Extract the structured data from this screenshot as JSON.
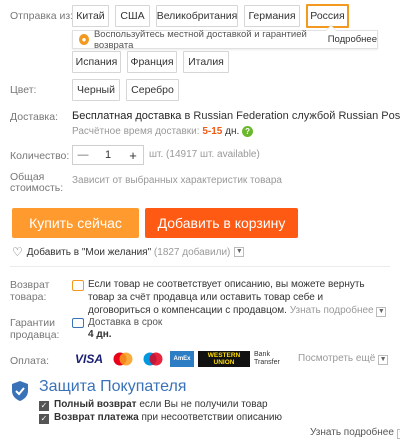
{
  "ship_from": {
    "label": "Отправка из:",
    "options": [
      "Китай",
      "США",
      "Великобритания",
      "Германия",
      "Россия",
      "Испания",
      "Франция",
      "Италия"
    ],
    "selected": "Россия",
    "tooltip_text": "Воспользуйтесь местной доставкой и гарантией возврата",
    "tooltip_link": "Подробнее"
  },
  "color": {
    "label": "Цвет:",
    "options": [
      "Черный",
      "Серебро"
    ]
  },
  "delivery": {
    "label": "Доставка:",
    "text_bold": "Бесплатная доставка",
    "text_rest": " в Russian Federation службой Russian Post",
    "eta_label": "Расчётное время доставки:",
    "eta_value": "5-15",
    "eta_unit": "дн."
  },
  "quantity": {
    "label": "Количество:",
    "minus": "—",
    "value": "1",
    "plus": "+",
    "unit": "шт. (14917 шт. available)"
  },
  "total": {
    "label_line1": "Общая",
    "label_line2": "стоимость:",
    "value": "Зависит от выбранных характеристик товара"
  },
  "actions": {
    "buy_now": "Купить сейчас",
    "add_to_cart": "Добавить в корзину",
    "wishlist": "Добавить в \"Мои желания\"",
    "wishlist_count": "(1827 добавили)"
  },
  "return": {
    "label_line1": "Возврат",
    "label_line2": "товара:",
    "text": "Если товар не соответствует описанию, вы можете вернуть товар за счёт продавца или оставить товар себе и договориться о компенсации с продавцом.",
    "link": "Узнать подробнее"
  },
  "guarantee": {
    "label_line1": "Гарантии",
    "label_line2": "продавца:",
    "line1": "Доставка в срок",
    "line2": "4 дн."
  },
  "payment": {
    "label": "Оплата:",
    "methods": [
      "VISA",
      "MasterCard",
      "Maestro",
      "AmEx",
      "WESTERN UNION",
      "Bank Transfer"
    ],
    "more": "Посмотреть ещё"
  },
  "protection": {
    "title": "Защита Покупателя",
    "item1_bold": "Полный возврат",
    "item1_rest": " если Вы не получили товар",
    "item2_bold": "Возврат платежа",
    "item2_rest": " при несоответствии описанию",
    "link": "Узнать подробнее"
  },
  "colors": {
    "accent_orange": "#f29a1f",
    "buy_now_bg": "#ff9a2e",
    "add_cart_bg": "#ff5a14",
    "eta_value": "#f25a14",
    "help_icon": "#6bb82d",
    "shield": "#3a72b7"
  }
}
